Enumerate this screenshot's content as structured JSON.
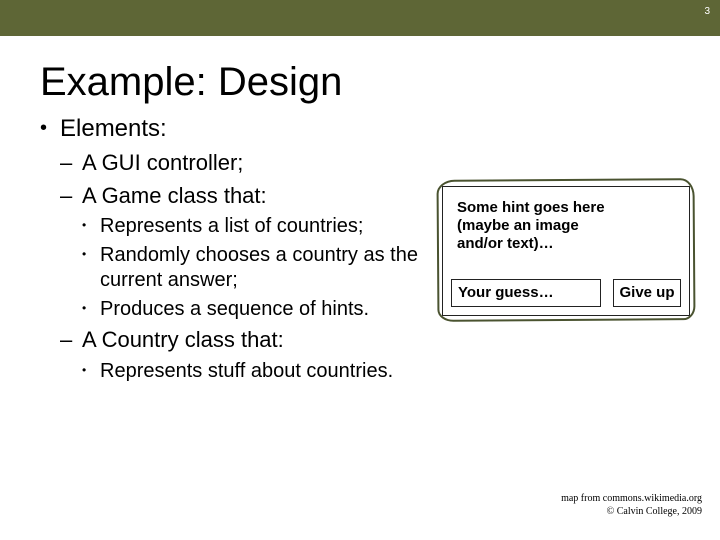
{
  "page_number": "3",
  "title": "Example: Design",
  "bullets": {
    "l1": "Elements:",
    "l2a": "A GUI controller;",
    "l2b": "A Game class that:",
    "l3a": "Represents a list of countries;",
    "l3b": "Randomly chooses a country   as the current answer;",
    "l3c": "Produces a sequence of hints.",
    "l2c": "A Country class that:",
    "l3d": "Represents stuff about countries."
  },
  "mock": {
    "hint": "Some hint goes here\n(maybe an image\n and/or text)…",
    "guess": "Your guess…",
    "giveup": "Give up"
  },
  "footer": {
    "line1": "map from commons.wikimedia.org",
    "line2": "© Calvin College, 2009"
  }
}
